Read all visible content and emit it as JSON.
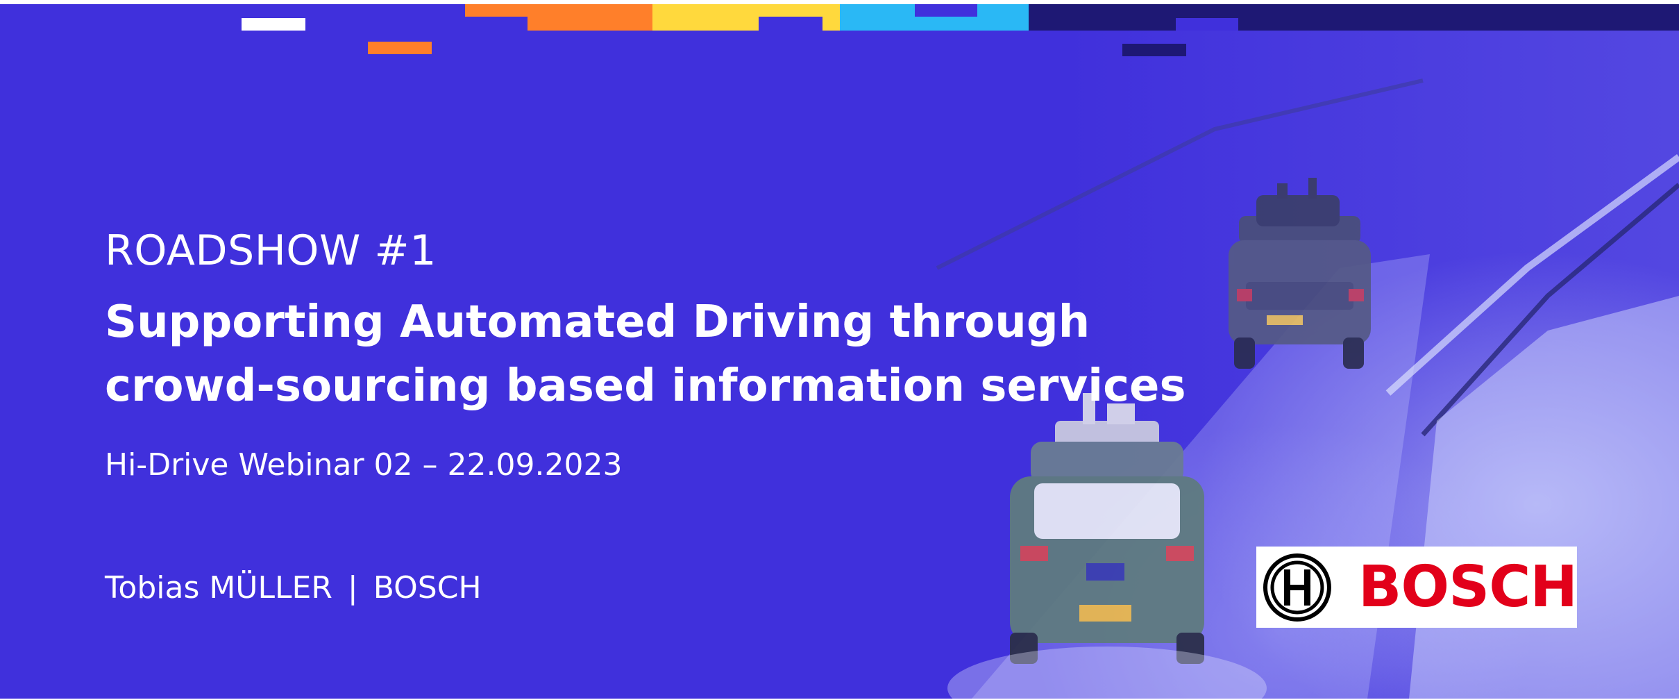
{
  "slide": {
    "kicker": "ROADSHOW #1",
    "title_line_1": "Supporting Automated Driving through",
    "title_line_2": "crowd-sourcing based information services",
    "subtitle": "Hi-Drive Webinar 02 – 22.09.2023",
    "author_name": "Tobias MÜLLER",
    "author_separator": "|",
    "author_org": "BOSCH"
  },
  "logo": {
    "wordmark": "BOSCH",
    "icon": "bosch-armature-emblem"
  },
  "photo": {
    "description_icon": "snowy-road-test-vehicles"
  },
  "colors": {
    "background": "#4030dc",
    "bar_white": "#ffffff",
    "bar_orange": "#ff7f2a",
    "bar_yellow": "#ffd93d",
    "bar_cyan": "#2ab8f5",
    "bar_navy": "#1e1874",
    "bosch_red": "#e2001a"
  }
}
